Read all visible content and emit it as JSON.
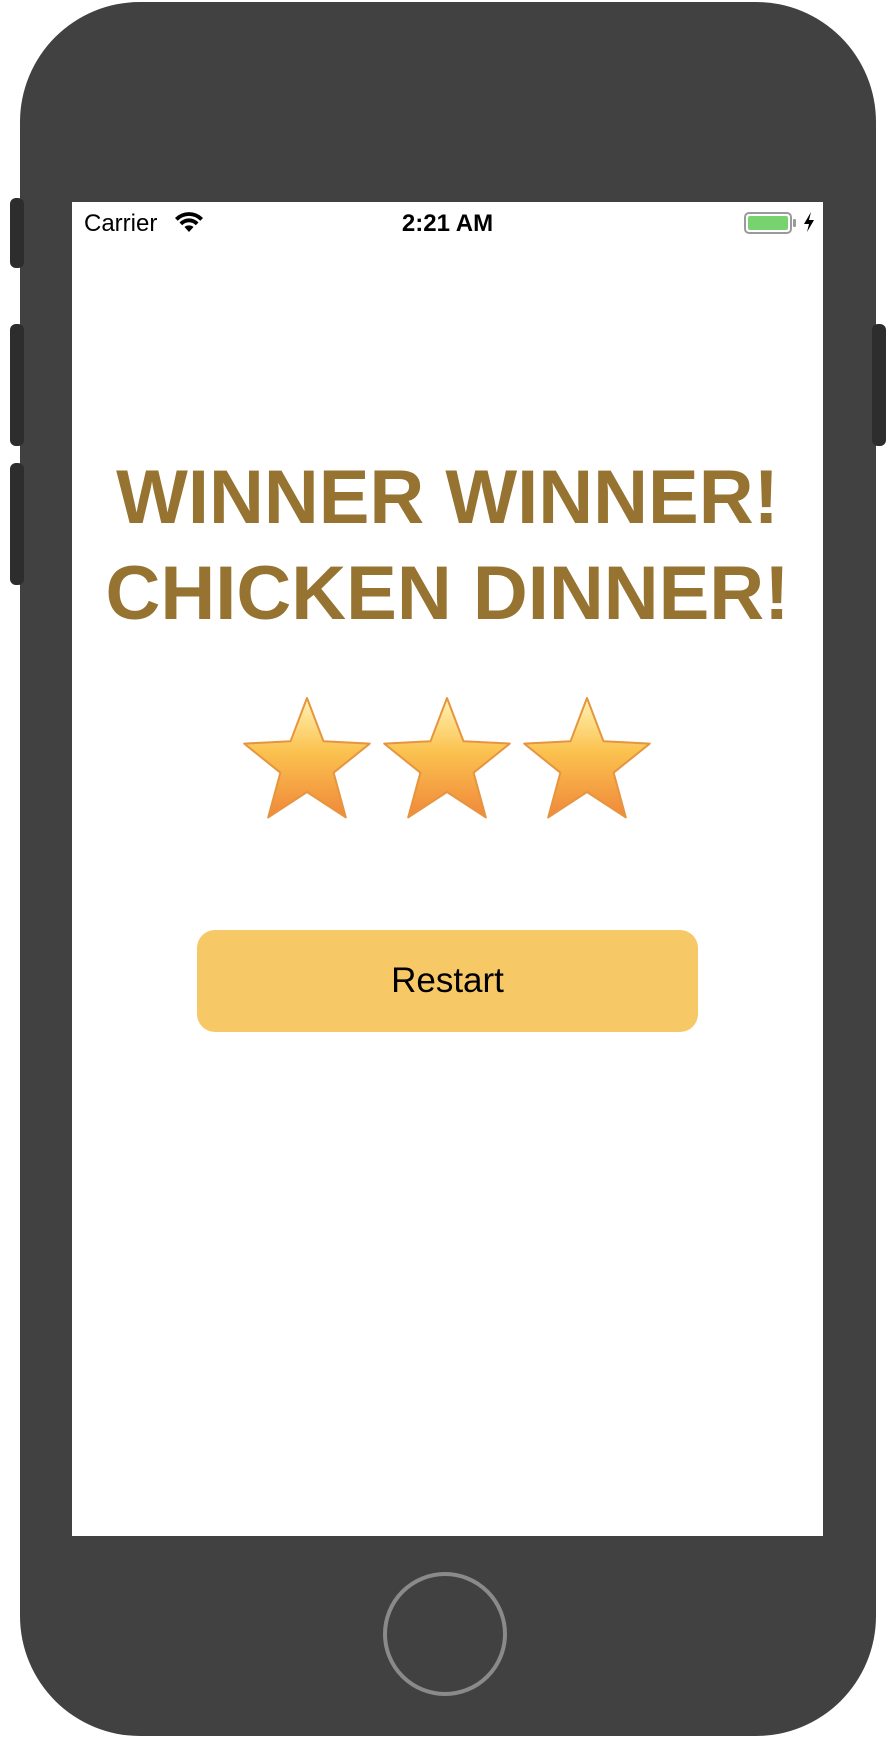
{
  "status_bar": {
    "carrier": "Carrier",
    "time": "2:21 AM",
    "battery_color": "#78d26f",
    "icons": [
      "wifi-icon",
      "battery-icon",
      "charging-bolt-icon"
    ]
  },
  "screen": {
    "title_line1": "WINNER WINNER!",
    "title_line2": "CHICKEN DINNER!",
    "title_color": "#967330",
    "rating": {
      "value": 3,
      "max": 3,
      "icon": "star-icon"
    },
    "restart_label": "Restart",
    "restart_color": "#f7c866"
  },
  "device": {
    "frame_color": "#414141",
    "home_button_icon": "home-button"
  }
}
